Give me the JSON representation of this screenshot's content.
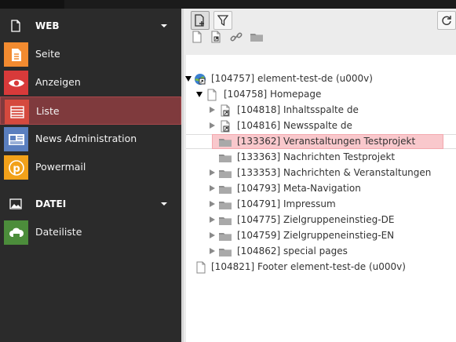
{
  "sidebar": {
    "groups": [
      {
        "label": "WEB",
        "icon": "page-icon",
        "modules": [
          {
            "label": "Seite",
            "icon": "page-doc-icon",
            "color": "#f28b30"
          },
          {
            "label": "Anzeigen",
            "icon": "eye-icon",
            "color": "#d83a3a"
          },
          {
            "label": "Liste",
            "icon": "list-icon",
            "color": "#d5493e",
            "active": true
          },
          {
            "label": "News Administration",
            "icon": "news-icon",
            "color": "#5a7fbf"
          },
          {
            "label": "Powermail",
            "icon": "powermail-icon",
            "color": "#f2a11a"
          }
        ]
      },
      {
        "label": "DATEI",
        "icon": "image-icon",
        "modules": [
          {
            "label": "Dateiliste",
            "icon": "cloud-folder-icon",
            "color": "#4c8d3b"
          }
        ]
      }
    ]
  },
  "toolbar": {
    "new_page_icon": "new-page-icon",
    "filter_icon": "filter-icon",
    "refresh_icon": "refresh-icon",
    "doktype_icons": [
      "page-icon",
      "shortcut-page-icon",
      "link-icon",
      "folder-icon"
    ]
  },
  "tree": {
    "root": {
      "label": "[104757] element-test-de (u000v)"
    },
    "homepage": {
      "label": "[104758] Homepage"
    },
    "children": [
      {
        "label": "[104818] Inhaltsspalte de",
        "icon": "shortcut-page-icon",
        "expandable": true
      },
      {
        "label": "[104816] Newsspalte de",
        "icon": "shortcut-page-icon",
        "expandable": true
      },
      {
        "label": "[133362] Veranstaltungen Testprojekt",
        "icon": "folder-icon",
        "expandable": false,
        "selected": true
      },
      {
        "label": "[133363] Nachrichten Testprojekt",
        "icon": "folder-icon",
        "expandable": false
      },
      {
        "label": "[133353] Nachrichten & Veranstaltungen",
        "icon": "folder-icon",
        "expandable": true
      },
      {
        "label": "[104793] Meta-Navigation",
        "icon": "folder-icon",
        "expandable": true
      },
      {
        "label": "[104791] Impressum",
        "icon": "folder-icon",
        "expandable": true
      },
      {
        "label": "[104775] Zielgruppeneinstieg-DE",
        "icon": "folder-icon",
        "expandable": true
      },
      {
        "label": "[104759] Zielgruppeneinstieg-EN",
        "icon": "folder-icon",
        "expandable": true
      },
      {
        "label": "[104862] special pages",
        "icon": "folder-icon",
        "expandable": true
      }
    ],
    "footer": {
      "label": "[104821] Footer element-test-de (u000v)"
    }
  }
}
